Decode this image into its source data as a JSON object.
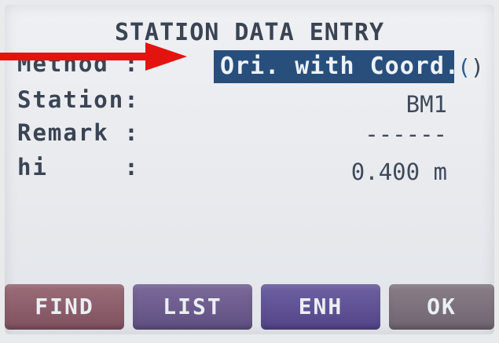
{
  "title": "STATION DATA ENTRY",
  "fields": [
    {
      "label": "Method :",
      "value": "Ori. with Coord."
    },
    {
      "label": "Station:",
      "value": "BM1"
    },
    {
      "label": "Remark :",
      "value": "------"
    },
    {
      "label": "hi     :",
      "value": "0.400 m"
    }
  ],
  "softkeys": [
    "FIND",
    "LIST",
    "ENH",
    "OK"
  ],
  "colors": {
    "selection": "#284f7c",
    "annotation_arrow": "#e3140f",
    "screen_bg": "#e8eaee"
  },
  "icons": {
    "toggle": "left-right-toggle-icon",
    "annotation": "red-arrow-icon"
  }
}
